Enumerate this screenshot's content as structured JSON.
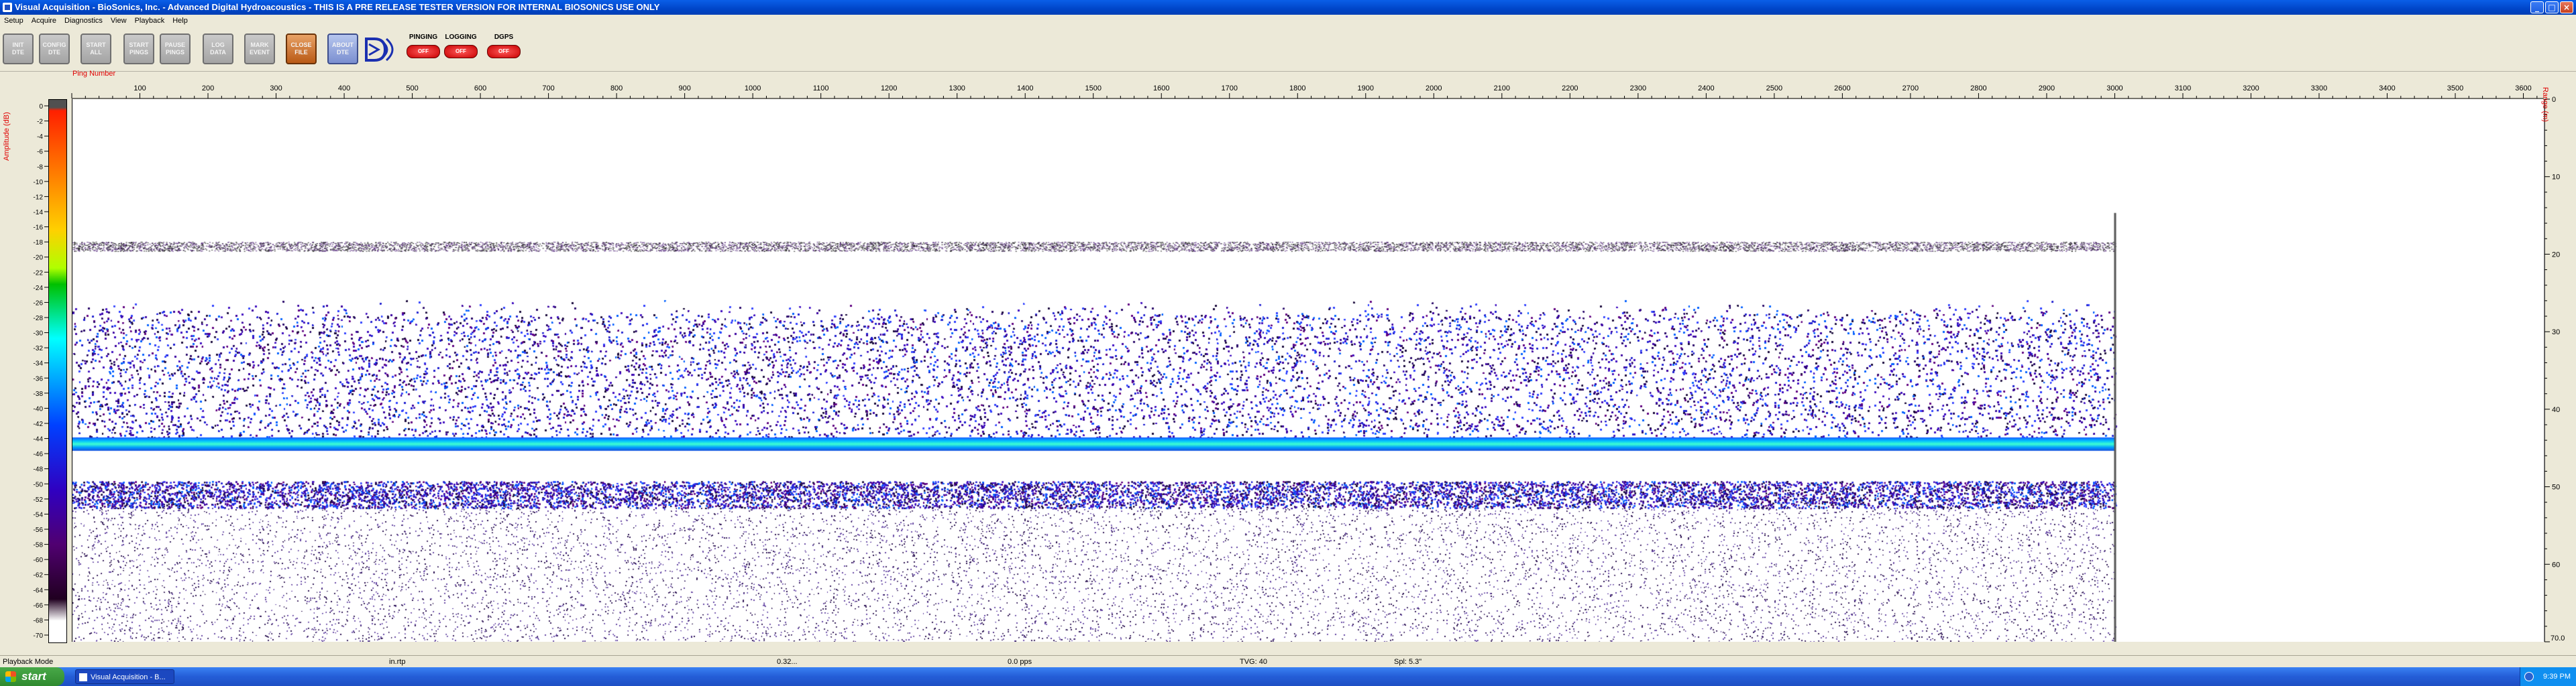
{
  "window": {
    "title": "Visual Acquisition  -  BioSonics, Inc.  -  Advanced Digital Hydroacoustics  -  THIS IS A PRE RELEASE TESTER VERSION FOR INTERNAL BIOSONICS USE ONLY",
    "minimize": "_",
    "maximize": "□",
    "close": "×"
  },
  "menu": [
    "Setup",
    "Acquire",
    "Diagnostics",
    "View",
    "Playback",
    "Help"
  ],
  "toolbar": {
    "buttons": [
      {
        "id": "init-dte",
        "label": "INIT\nDTE"
      },
      {
        "id": "config-dte",
        "label": "CONFIG\nDTE"
      },
      {
        "id": "start-all",
        "label": "START\nALL"
      },
      {
        "id": "start-pings",
        "label": "START\nPINGS"
      },
      {
        "id": "pause-pings",
        "label": "PAUSE\nPINGS"
      },
      {
        "id": "log-data",
        "label": "LOG\nDATA"
      },
      {
        "id": "mark-event",
        "label": "MARK\nEVENT"
      },
      {
        "id": "close-file",
        "label": "CLOSE\nFILE"
      },
      {
        "id": "about-dte",
        "label": "ABOUT\nDTE"
      }
    ],
    "indicators": [
      {
        "label": "PINGING",
        "state": "OFF"
      },
      {
        "label": "LOGGING",
        "state": "OFF"
      },
      {
        "label": "DGPS",
        "state": "OFF"
      }
    ]
  },
  "echogram": {
    "x_axis_label": "Ping Number",
    "x_ticks": [
      100,
      200,
      300,
      400,
      500,
      600,
      700,
      800,
      900,
      1000,
      1100,
      1200,
      1300,
      1400,
      1500,
      1600,
      1700,
      1800,
      1900,
      2000,
      2100,
      2200,
      2300,
      2400,
      2500,
      2600,
      2700,
      2800,
      2900,
      3000,
      3100,
      3200,
      3300,
      3400,
      3500,
      3600
    ],
    "x_range": [
      0,
      3630
    ],
    "data_end_ping": 3000,
    "amplitude_label": "Amplitude (dB)",
    "amplitude_ticks": [
      0,
      -2,
      -4,
      -6,
      -8,
      -10,
      -12,
      -14,
      -16,
      -18,
      -20,
      -22,
      -24,
      -26,
      -28,
      -30,
      -32,
      -34,
      -36,
      -38,
      -40,
      -42,
      -44,
      -46,
      -48,
      -50,
      -52,
      -54,
      -56,
      -58,
      -60,
      -62,
      -64,
      -66,
      -68,
      -70
    ],
    "range_label": "Range (m)",
    "range_ticks": [
      0,
      10,
      20,
      30,
      40,
      50,
      60
    ],
    "range_max": 70.0,
    "range_max_label": "70.0",
    "surface_line_m": 19,
    "scatter_layer_m": [
      28,
      44
    ],
    "bottom_m": 44.5,
    "second_echo_m": 51
  },
  "status": {
    "mode": "Playback Mode",
    "f1": "in.rtp",
    "f2": "0.32...",
    "f3": "0.0 pps",
    "f4": "TVG: 40",
    "f5": "Spl: 5.3\""
  },
  "taskbar": {
    "start": "start",
    "task": "Visual Acquisition - B...",
    "clock": "9:39 PM"
  }
}
